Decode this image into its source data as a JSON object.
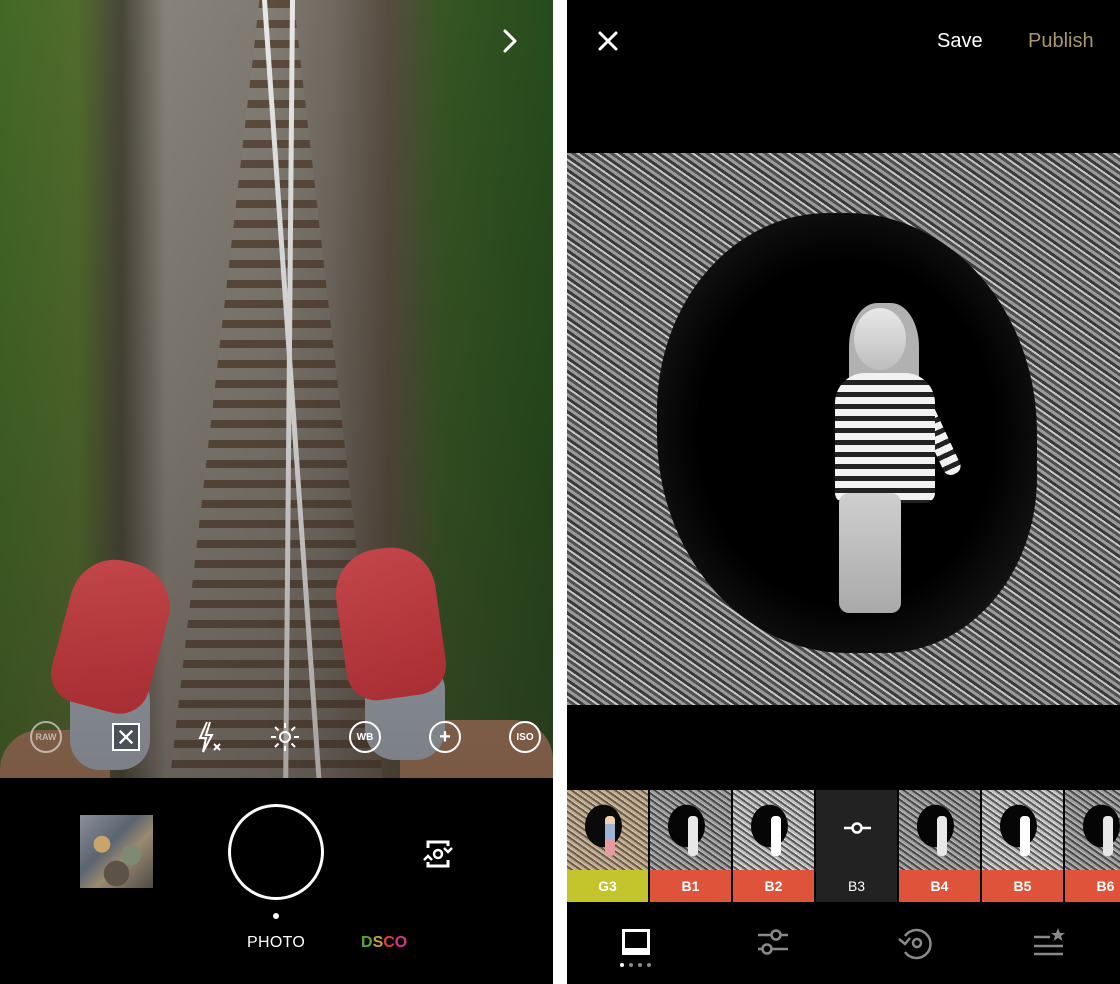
{
  "camera": {
    "tools": [
      {
        "name": "raw-toggle",
        "label": "RAW",
        "icon": "raw-icon"
      },
      {
        "name": "grid-toggle",
        "label": "",
        "icon": "grid-off-icon"
      },
      {
        "name": "flash-toggle",
        "label": "",
        "icon": "flash-off-icon"
      },
      {
        "name": "exposure",
        "label": "",
        "icon": "exposure-sun-icon"
      },
      {
        "name": "white-balance",
        "label": "WB",
        "icon": "wb-icon"
      },
      {
        "name": "add-setting",
        "label": "+",
        "icon": "plus-icon"
      },
      {
        "name": "iso",
        "label": "ISO",
        "icon": "iso-icon"
      }
    ],
    "next_icon": "chevron-right-icon",
    "modes": {
      "photo": "PHOTO",
      "dsco": [
        "D",
        "S",
        "C",
        "O"
      ],
      "dsco_colors": [
        "#5aa832",
        "#c9a227",
        "#e0402f",
        "#d8338a"
      ]
    },
    "flip_icon": "flip-camera-icon"
  },
  "editor": {
    "close_icon": "close-icon",
    "save_label": "Save",
    "publish_label": "Publish",
    "publish_color": "#a89870",
    "filters": [
      {
        "label": "G3",
        "color": "#c4c42c",
        "thumb": "color"
      },
      {
        "label": "B1",
        "color": "#e0533b",
        "thumb": "bw"
      },
      {
        "label": "B2",
        "color": "#e0533b",
        "thumb": "bw-light"
      },
      {
        "label": "B3",
        "color": "#222222",
        "thumb": "active",
        "active": true
      },
      {
        "label": "B4",
        "color": "#e0533b",
        "thumb": "bw"
      },
      {
        "label": "B5",
        "color": "#e0533b",
        "thumb": "bw-light"
      },
      {
        "label": "B6",
        "color": "#e0533b",
        "thumb": "bw"
      }
    ],
    "bottom_tabs": [
      {
        "name": "presets",
        "icon": "presets-icon",
        "active": true
      },
      {
        "name": "tools",
        "icon": "sliders-icon",
        "active": false
      },
      {
        "name": "history",
        "icon": "history-icon",
        "active": false
      },
      {
        "name": "recipes",
        "icon": "recipes-star-icon",
        "active": false
      }
    ],
    "page_dots": {
      "count": 4,
      "active_index": 0
    }
  }
}
